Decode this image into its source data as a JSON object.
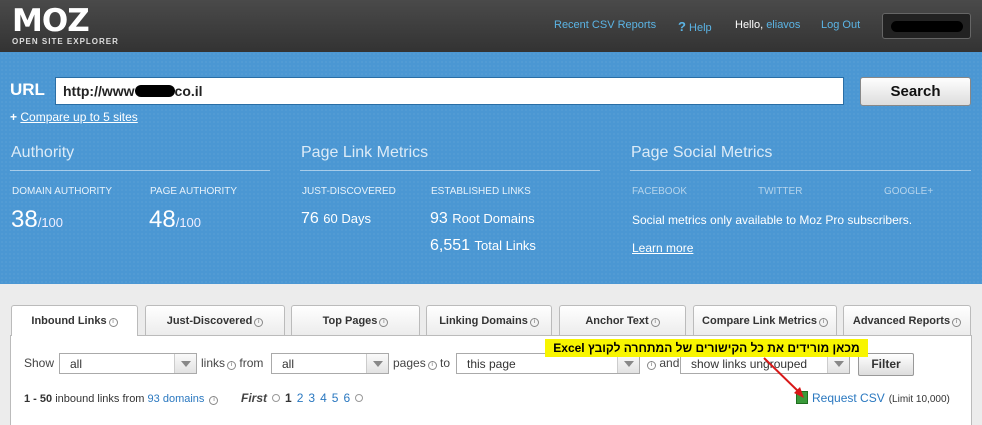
{
  "header": {
    "logo": "MOZ",
    "logo_sub": "OPEN SITE EXPLORER",
    "recent_csv": "Recent CSV Reports",
    "help": "Help",
    "hello": "Hello,",
    "username": "eliavos",
    "logout": "Log Out"
  },
  "search": {
    "url_label": "URL",
    "url_prefix": "http://www",
    "url_suffix": "co.il",
    "search_button": "Search",
    "compare_prefix": "+",
    "compare_link": "Compare up to 5 sites"
  },
  "authority": {
    "title": "Authority",
    "domain_label": "DOMAIN AUTHORITY",
    "domain_value": "38",
    "domain_max": "/100",
    "page_label": "PAGE AUTHORITY",
    "page_value": "48",
    "page_max": "/100"
  },
  "page_link_metrics": {
    "title": "Page Link Metrics",
    "just_label": "JUST-DISCOVERED",
    "just_value": "76",
    "just_unit": "60 Days",
    "established_label": "ESTABLISHED LINKS",
    "root_value": "93",
    "root_unit": "Root Domains",
    "total_value": "6,551",
    "total_unit": "Total Links"
  },
  "social": {
    "title": "Page Social Metrics",
    "facebook": "FACEBOOK",
    "twitter": "TWITTER",
    "google": "GOOGLE+",
    "note": "Social metrics only available to Moz Pro subscribers.",
    "learn_more": "Learn more"
  },
  "tabs": [
    {
      "label": "Inbound Links"
    },
    {
      "label": "Just-Discovered"
    },
    {
      "label": "Top Pages"
    },
    {
      "label": "Linking Domains"
    },
    {
      "label": "Anchor Text"
    },
    {
      "label": "Compare Link Metrics"
    },
    {
      "label": "Advanced Reports"
    }
  ],
  "filter": {
    "show": "Show",
    "select1": "all",
    "links": "links",
    "from": "from",
    "select2": "all",
    "pages": "pages",
    "to": "to",
    "select3": "this page",
    "and": "and",
    "select4": "show links ungrouped",
    "filter_button": "Filter"
  },
  "annotation": "מכאן מורידים את כל הקישורים של המתחרה לקובץ Excel",
  "results": {
    "range": "1 - 50",
    "text": "inbound links from",
    "domains": "93 domains"
  },
  "pager": {
    "first": "First",
    "pages": [
      "1",
      "2",
      "3",
      "4",
      "5",
      "6"
    ]
  },
  "csv": {
    "label": "Request CSV",
    "limit": "(Limit 10,000)"
  },
  "colors": {
    "header_bg": "#3a3a3a",
    "band_bg": "#4b97d3",
    "link": "#2a78c0",
    "annotation_bg": "#f8f500"
  }
}
